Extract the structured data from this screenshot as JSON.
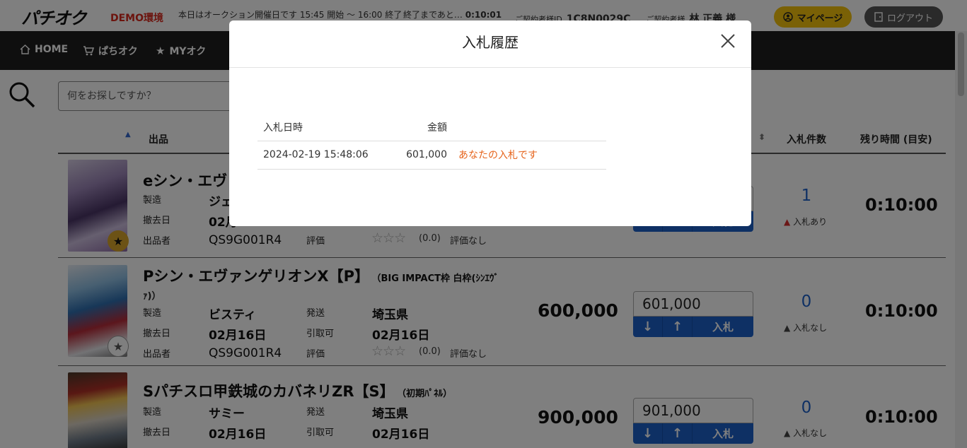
{
  "header": {
    "logo": "パチオク",
    "env": "DEMO環境",
    "today_info": "本日はオークション開催日です 15:45 開始 ～ 16:00 終了",
    "remain_label": "終了まであと…",
    "remain_time": "0:10:01",
    "contract_id_label": "ご契約者様ID",
    "contract_id": "1C8N0029C",
    "contract_name_label": "ご契約者様",
    "contract_name": "林 正義 様",
    "mypage_label": "マイページ",
    "logout_label": "ログアウト",
    "accent": "#f4c20d"
  },
  "nav": {
    "items": [
      {
        "label": "HOME",
        "icon": "home-icon"
      },
      {
        "label": "ぱちオク",
        "icon": "cart-icon"
      },
      {
        "label": "MYオク",
        "icon": "star-icon"
      }
    ]
  },
  "search": {
    "placeholder": "何をお探しですか？"
  },
  "table": {
    "headers": {
      "item": "出品",
      "bid_count": "入札件数",
      "time_left": "残り時間 (目安)"
    },
    "labels": {
      "maker": "製造",
      "removed": "撤去日",
      "seller": "出品者",
      "shipping": "発送",
      "pickup": "引取可",
      "eval": "評価"
    },
    "rows": [
      {
        "title": "eシン・エヴ",
        "subtitle": "",
        "maker": "ジェ",
        "shipping": "",
        "removed": "02月",
        "pickup": "",
        "seller": "QS9G001R4",
        "rating": "(0.0)",
        "rating_text": "評価なし",
        "price": "",
        "bid_value": "",
        "bid_count": "1",
        "bid_state": "入札あり",
        "time_left": "0:10:00",
        "favorite": true
      },
      {
        "title": "Pシン・エヴァンゲリオンX【P】",
        "subtitle": "（BIG IMPACT枠 白枠(ｼﾝｴｳﾞ",
        "subtitle2": "ｧ)）",
        "maker": "ビスティ",
        "shipping": "埼玉県",
        "removed": "02月16日",
        "pickup": "02月16日",
        "seller": "QS9G001R4",
        "rating": "(0.0)",
        "rating_text": "評価なし",
        "price": "600,000",
        "bid_value": "601,000",
        "bid_count": "0",
        "bid_state": "入札なし",
        "time_left": "0:10:00",
        "favorite": false
      },
      {
        "title": "Sパチスロ甲鉄城のカバネリZR【S】",
        "subtitle": "（初期ﾊﾟﾈﾙ）",
        "maker": "サミー",
        "shipping": "埼玉県",
        "removed": "02月16日",
        "pickup": "02月16日",
        "seller": "",
        "rating": "",
        "rating_text": "",
        "price": "900,000",
        "bid_value": "901,000",
        "bid_count": "0",
        "bid_state": "入札なし",
        "time_left": "0:10:00",
        "favorite": false
      }
    ],
    "bid_buttons": {
      "down": "↓",
      "up": "↑",
      "bid": "入札"
    }
  },
  "modal": {
    "title": "入札履歴",
    "columns": {
      "datetime": "入札日時",
      "amount": "金額"
    },
    "rows": [
      {
        "datetime": "2024-02-19 15:48:06",
        "amount": "601,000",
        "note": "あなたの入札です"
      }
    ],
    "note_color": "#e6641c"
  }
}
